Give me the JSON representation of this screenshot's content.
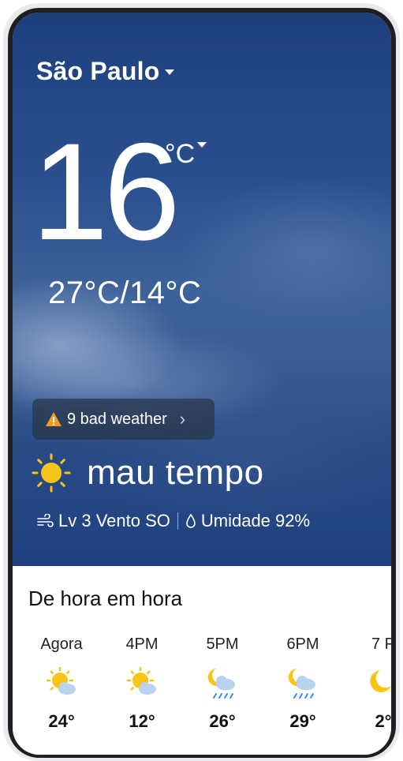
{
  "city": "São Paulo",
  "current": {
    "temperature": "16",
    "unit": "°C",
    "high_low": "27°C/14°C",
    "alert_text": "9 bad weather",
    "condition": "mau tempo",
    "wind": "Lv 3 Vento SO",
    "humidity": "Umidade 92%"
  },
  "hourly": {
    "title": "De hora em hora",
    "items": [
      {
        "time": "Agora",
        "temp": "24°",
        "icon": "sun-cloud-icon"
      },
      {
        "time": "4PM",
        "temp": "12°",
        "icon": "sun-cloud-icon"
      },
      {
        "time": "5PM",
        "temp": "26°",
        "icon": "moon-cloud-rain-icon"
      },
      {
        "time": "6PM",
        "temp": "29°",
        "icon": "moon-cloud-rain-icon"
      },
      {
        "time": "7 P",
        "temp": "2°",
        "icon": "moon-icon"
      }
    ]
  },
  "colors": {
    "sky_top": "#1d3f7e",
    "sun": "#f5c518",
    "warning": "#f59a23",
    "rain": "#3a8ee6"
  }
}
